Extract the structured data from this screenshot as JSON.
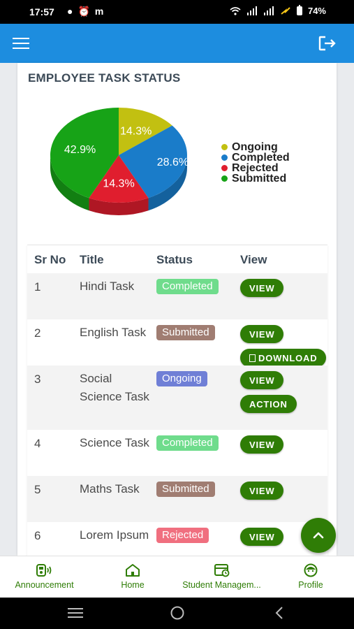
{
  "status_bar": {
    "time": "17:57",
    "carrier_icon": "m",
    "battery_percent": "74%"
  },
  "section": {
    "title": "EMPLOYEE TASK STATUS"
  },
  "chart_data": {
    "type": "pie",
    "title": "",
    "slices": [
      {
        "label": "Ongoing",
        "value": 14.3,
        "display": "14.3%",
        "color": "#c2c011"
      },
      {
        "label": "Completed",
        "value": 28.6,
        "display": "28.6%",
        "color": "#1a7cc9"
      },
      {
        "label": "Rejected",
        "value": 14.3,
        "display": "14.3%",
        "color": "#e01e2e"
      },
      {
        "label": "Submitted",
        "value": 42.9,
        "display": "42.9%",
        "color": "#17a317"
      }
    ],
    "legend_position": "right"
  },
  "table": {
    "headers": {
      "sr": "Sr No",
      "title": "Title",
      "status": "Status",
      "view": "View"
    },
    "rows": [
      {
        "sr": "1",
        "title": "Hindi Task",
        "status": "Completed",
        "status_class": "b-completed",
        "actions": [
          "VIEW"
        ]
      },
      {
        "sr": "2",
        "title": "English Task",
        "status": "Submitted",
        "status_class": "b-submitted",
        "actions": [
          "VIEW",
          "DOWNLOAD"
        ]
      },
      {
        "sr": "3",
        "title": "Social Science Task",
        "status": "Ongoing",
        "status_class": "b-ongoing",
        "actions": [
          "VIEW",
          "ACTION"
        ]
      },
      {
        "sr": "4",
        "title": "Science Task",
        "status": "Completed",
        "status_class": "b-completed",
        "actions": [
          "VIEW"
        ]
      },
      {
        "sr": "5",
        "title": "Maths Task",
        "status": "Submitted",
        "status_class": "b-submitted",
        "actions": [
          "VIEW"
        ]
      },
      {
        "sr": "6",
        "title": "Lorem Ipsum",
        "status": "Rejected",
        "status_class": "b-rejected",
        "actions": [
          "VIEW"
        ]
      }
    ]
  },
  "bottom_nav": {
    "items": [
      {
        "label": "Announcement",
        "icon": "announcement-icon"
      },
      {
        "label": "Home",
        "icon": "home-icon"
      },
      {
        "label": "Student Managem...",
        "icon": "student-management-icon"
      },
      {
        "label": "Profile",
        "icon": "profile-icon"
      }
    ]
  },
  "colors": {
    "app_bar": "#1d8ddf",
    "accent_green": "#2f7d06"
  }
}
